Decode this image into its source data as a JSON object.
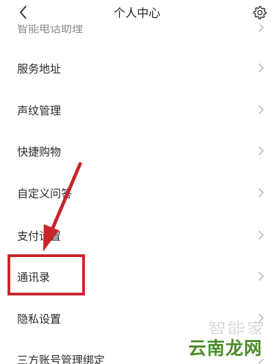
{
  "header": {
    "title": "个人中心"
  },
  "menu": {
    "items": [
      {
        "label": "智能电话助理"
      },
      {
        "label": "服务地址"
      },
      {
        "label": "声纹管理"
      },
      {
        "label": "快捷购物"
      },
      {
        "label": "自定义问答"
      },
      {
        "label": "支付设置"
      },
      {
        "label": "通讯录"
      },
      {
        "label": "隐私设置"
      },
      {
        "label": "三方账号管理绑定"
      }
    ]
  },
  "watermarks": {
    "faint": "智能家",
    "logo": "云南龙网"
  },
  "colors": {
    "highlight": "#c8252b",
    "chevron": "#b9b9b9",
    "logo_text": "#4a8a28"
  }
}
